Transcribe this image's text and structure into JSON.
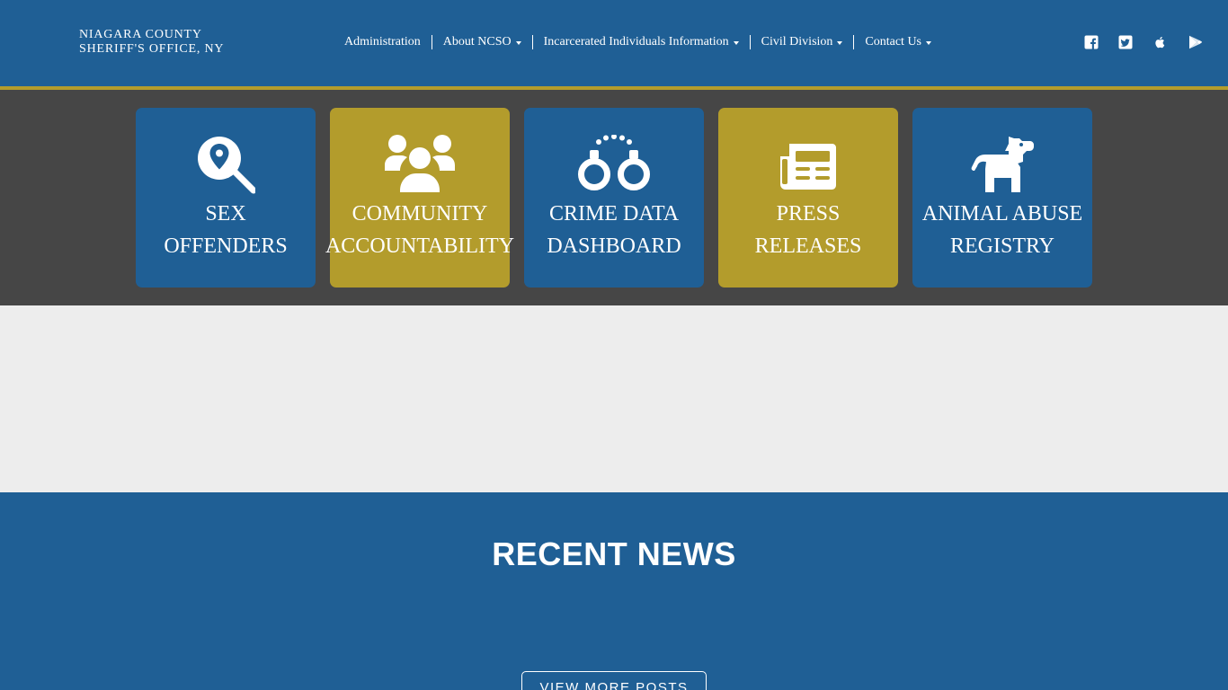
{
  "header": {
    "brand_line1": "NIAGARA COUNTY",
    "brand_line2": "SHERIFF'S OFFICE, NY",
    "nav": [
      {
        "label": "Administration",
        "has_dropdown": false
      },
      {
        "label": "About NCSO",
        "has_dropdown": true
      },
      {
        "label": "Incarcerated Individuals Information",
        "has_dropdown": true
      },
      {
        "label": "Civil Division",
        "has_dropdown": true
      },
      {
        "label": "Contact Us",
        "has_dropdown": true
      }
    ],
    "social_icons": [
      "facebook-icon",
      "twitter-icon",
      "apple-icon",
      "google-play-icon"
    ]
  },
  "tiles": [
    {
      "line1": "SEX",
      "line2": "OFFENDERS",
      "icon": "search-location-icon",
      "color": "blue"
    },
    {
      "line1": "COMMUNITY",
      "line2": "ACCOUNTABILITY",
      "icon": "users-icon",
      "color": "gold"
    },
    {
      "line1": "CRIME DATA",
      "line2": "DASHBOARD",
      "icon": "handcuffs-icon",
      "color": "blue"
    },
    {
      "line1": "PRESS",
      "line2": "RELEASES",
      "icon": "newspaper-icon",
      "color": "gold"
    },
    {
      "line1": "ANIMAL ABUSE",
      "line2": "REGISTRY",
      "icon": "dog-icon",
      "color": "blue"
    }
  ],
  "news": {
    "title": "RECENT NEWS",
    "more_button": "VIEW MORE POSTS"
  },
  "colors": {
    "primary_blue": "#1f5f95",
    "gold": "#b39c2c",
    "dark_band": "#464646",
    "light_band": "#ededed"
  }
}
